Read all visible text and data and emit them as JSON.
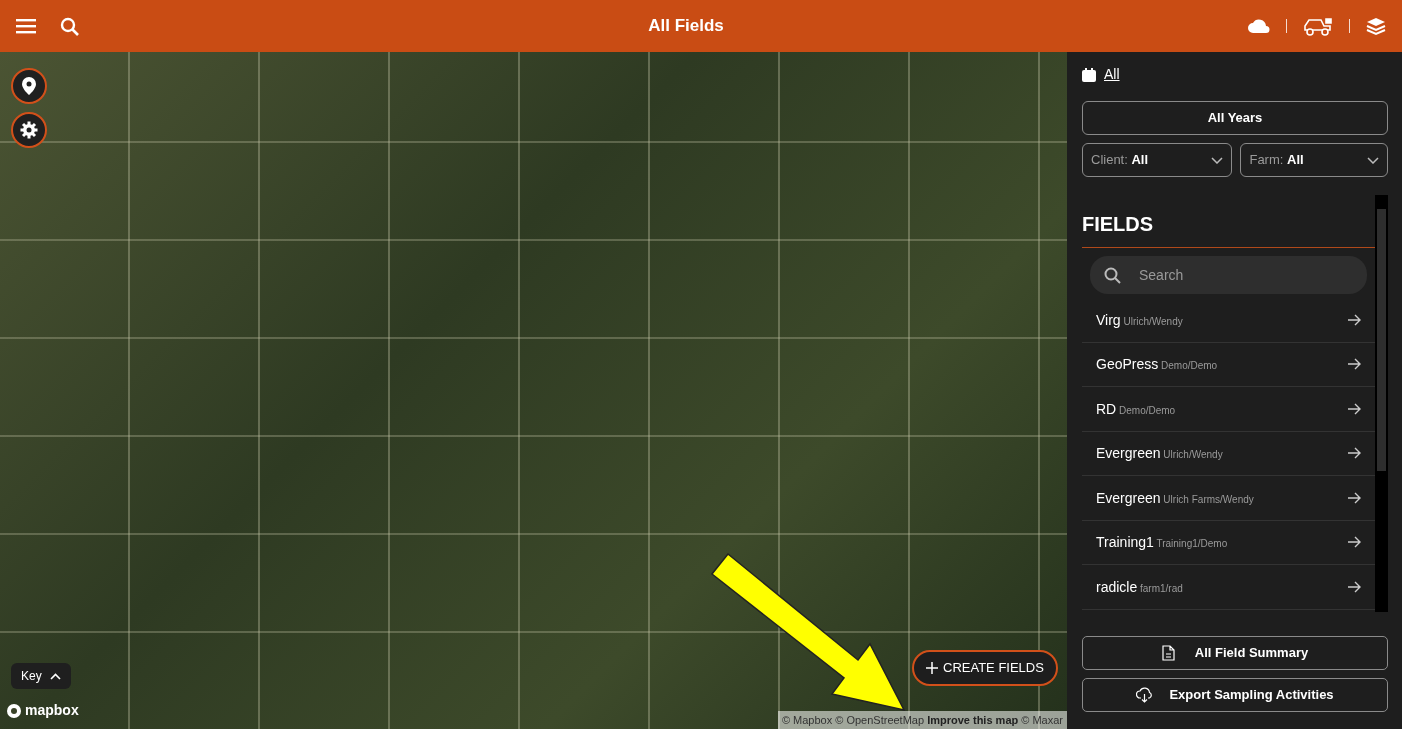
{
  "header": {
    "title": "All Fields"
  },
  "map": {
    "create_button": "CREATE FIELDS",
    "key_label": "Key",
    "logo_text": "mapbox",
    "attribution": {
      "text_1": "© Mapbox © OpenStreetMap",
      "link": "Improve this map",
      "text_2": "© Maxar"
    }
  },
  "sidebar": {
    "season_link": "All",
    "years_button": "All Years",
    "filters": [
      {
        "label": "Client:",
        "value": "All"
      },
      {
        "label": "Farm:",
        "value": "All"
      }
    ],
    "fields_heading": "FIELDS",
    "search": {
      "placeholder": "Search"
    },
    "fields": [
      {
        "name": "Virg",
        "path": "Ulrich/Wendy"
      },
      {
        "name": "GeoPress",
        "path": "Demo/Demo"
      },
      {
        "name": "RD",
        "path": "Demo/Demo"
      },
      {
        "name": "Evergreen",
        "path": "Ulrich/Wendy"
      },
      {
        "name": "Evergreen",
        "path": "Ulrich Farms/Wendy"
      },
      {
        "name": "Training1",
        "path": "Training1/Demo"
      },
      {
        "name": "radicle",
        "path": "farm1/rad"
      }
    ],
    "actions": [
      {
        "kind": "summary",
        "label": "All Field Summary"
      },
      {
        "kind": "export",
        "label": "Export Sampling Activities"
      }
    ]
  }
}
